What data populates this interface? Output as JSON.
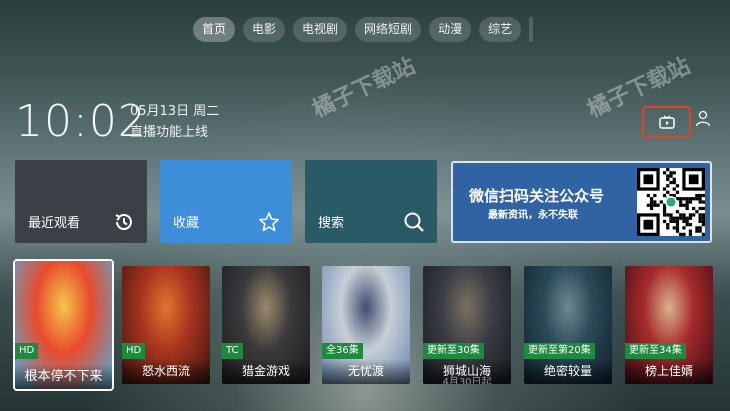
{
  "nav": {
    "tabs": [
      {
        "label": "首页",
        "active": true
      },
      {
        "label": "电影",
        "active": false
      },
      {
        "label": "电视剧",
        "active": false
      },
      {
        "label": "网络短剧",
        "active": false
      },
      {
        "label": "动漫",
        "active": false
      },
      {
        "label": "综艺",
        "active": false
      }
    ]
  },
  "status": {
    "time": "10:02",
    "date": "05月13日 周二",
    "notice": "直播功能上线"
  },
  "tiles": {
    "recent": {
      "label": "最近观看",
      "icon": "history-icon"
    },
    "favorites": {
      "label": "收藏",
      "icon": "star-icon"
    },
    "search": {
      "label": "搜索",
      "icon": "search-icon"
    }
  },
  "qr_card": {
    "title": "微信扫码关注公众号",
    "subtitle": "最新资讯，永不失联"
  },
  "posters": [
    {
      "title": "根本停不下来",
      "badge": "HD",
      "badge_color": "#1d8b3e",
      "colors": [
        "#4fb0e0",
        "#e84b2e",
        "#f4c64a"
      ]
    },
    {
      "title": "怒水西流",
      "badge": "HD",
      "badge_color": "#1d8b3e",
      "colors": [
        "#3a1410",
        "#a8351f",
        "#e2742d"
      ]
    },
    {
      "title": "猎金游戏",
      "badge": "TC",
      "badge_color": "#1d8b3e",
      "colors": [
        "#1b1c1f",
        "#3a3a3c",
        "#9a8a6a"
      ]
    },
    {
      "title": "无忧渡",
      "badge": "全36集",
      "badge_color": "#1d8b3e",
      "colors": [
        "#6a89b4",
        "#c7cfd6",
        "#3f4e70"
      ]
    },
    {
      "title": "狮城山海",
      "badge": "更新至30集",
      "badge_color": "#1d8b3e",
      "colors": [
        "#151a1f",
        "#3b3f45",
        "#7c6f62"
      ]
    },
    {
      "title": "绝密较量",
      "badge": "更新至第20集",
      "badge_color": "#1d8b3e",
      "colors": [
        "#10202c",
        "#2a4a58",
        "#6e8791"
      ]
    },
    {
      "title": "榜上佳婿",
      "badge": "更新至34集",
      "badge_color": "#1d8b3e",
      "colors": [
        "#3a0d12",
        "#a62a2c",
        "#d9b28a"
      ]
    }
  ],
  "poster_overlay": "4月30日起",
  "watermark": "橘子下载站"
}
